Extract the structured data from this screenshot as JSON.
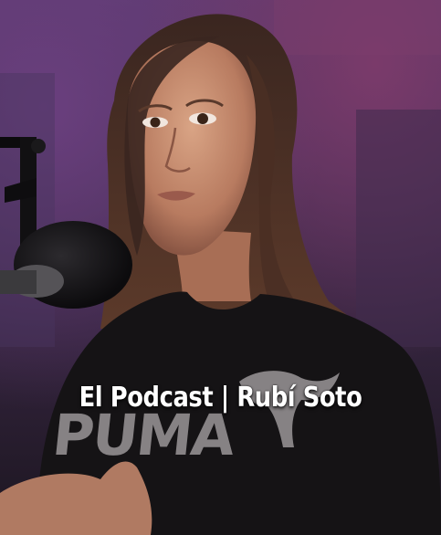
{
  "video": {
    "caption": "El Podcast | Rubí Soto",
    "shirt_brand": "PUMA"
  },
  "colors": {
    "background_purple": "#5a3a6e",
    "shirt": "#151315",
    "caption_text": "#ffffff"
  },
  "icons": [
    "microphone-icon",
    "puma-logo-icon"
  ]
}
